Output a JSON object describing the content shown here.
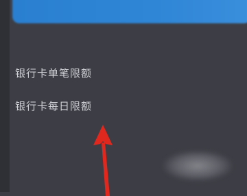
{
  "limits": {
    "items": [
      {
        "label": "银行卡单笔限额"
      },
      {
        "label": "银行卡每日限额"
      }
    ]
  },
  "annotation": {
    "arrow_color": "#e0281f"
  },
  "colors": {
    "background": "#3d3e45",
    "banner": "#2f86d6",
    "text": "#cfd0d6"
  }
}
